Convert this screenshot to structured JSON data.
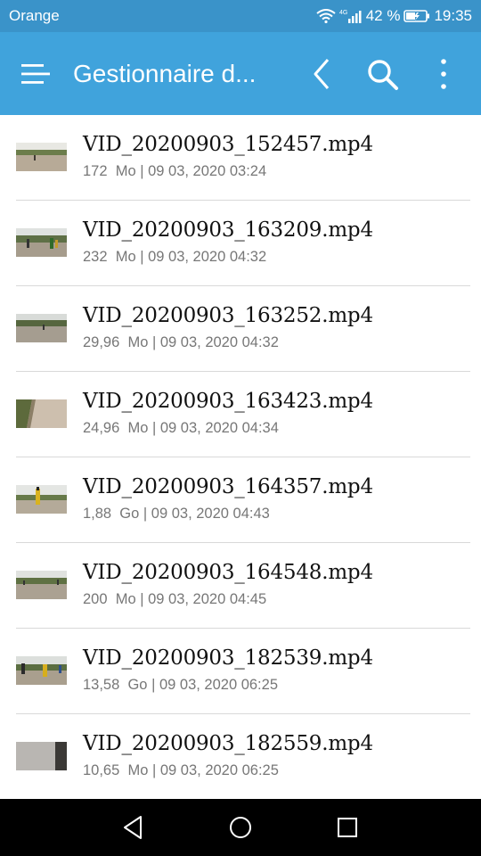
{
  "status_bar": {
    "carrier": "Orange",
    "network": "4G",
    "battery": "42 %",
    "time": "19:35",
    "icons": [
      "wifi-icon",
      "signal-icon",
      "battery-icon"
    ]
  },
  "app_bar": {
    "title": "Gestionnaire d...",
    "icons": [
      "menu-icon",
      "back-icon",
      "search-icon",
      "more-vertical-icon"
    ]
  },
  "files": [
    {
      "name": "VID_20200903_152457.mp4",
      "size": "172",
      "unit": "Mo",
      "date": "09 03, 2020 03:24"
    },
    {
      "name": "VID_20200903_163209.mp4",
      "size": "232",
      "unit": "Mo",
      "date": "09 03, 2020 04:32"
    },
    {
      "name": "VID_20200903_163252.mp4",
      "size": "29,96",
      "unit": "Mo",
      "date": "09 03, 2020 04:32"
    },
    {
      "name": "VID_20200903_163423.mp4",
      "size": "24,96",
      "unit": "Mo",
      "date": "09 03, 2020 04:34"
    },
    {
      "name": "VID_20200903_164357.mp4",
      "size": "1,88",
      "unit": "Go",
      "date": "09 03, 2020 04:43"
    },
    {
      "name": "VID_20200903_164548.mp4",
      "size": "200",
      "unit": "Mo",
      "date": "09 03, 2020 04:45"
    },
    {
      "name": "VID_20200903_182539.mp4",
      "size": "13,58",
      "unit": "Go",
      "date": "09 03, 2020 06:25"
    },
    {
      "name": "VID_20200903_182559.mp4",
      "size": "10,65",
      "unit": "Mo",
      "date": "09 03, 2020 06:25"
    }
  ],
  "nav_bar": {
    "icons": [
      "nav-back-icon",
      "nav-home-icon",
      "nav-recents-icon"
    ]
  },
  "colors": {
    "status_bar_bg": "#3a93c9",
    "app_bar_bg": "#40a3dc",
    "nav_bar_bg": "#000000",
    "divider": "#d9d9d9",
    "meta_text": "#777777"
  }
}
